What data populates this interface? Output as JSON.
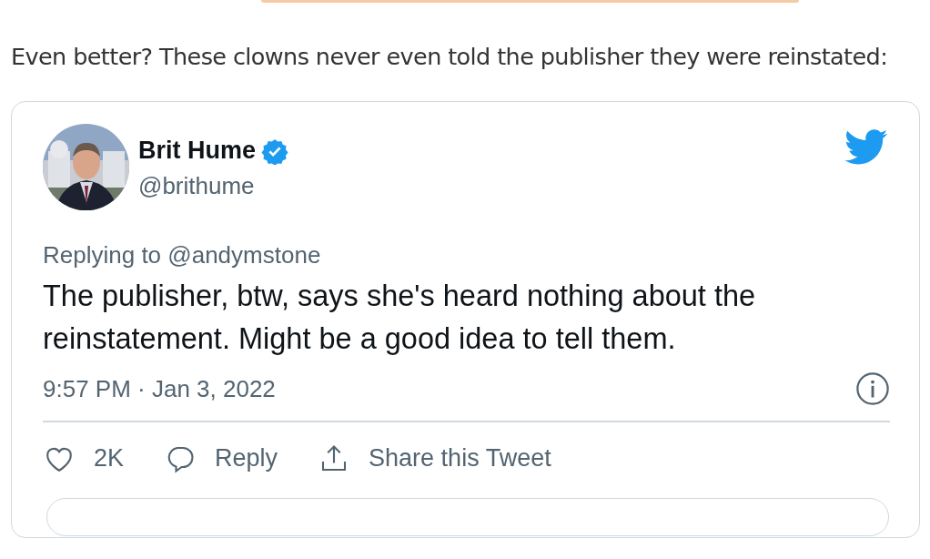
{
  "intro": "Even better? These clowns never even told the publisher they were reinstated:",
  "tweet": {
    "author": "Brit Hume",
    "verified": true,
    "handle": "@brithume",
    "replying_to": "Replying to @andymstone",
    "text": "The publisher, btw, says she's heard nothing about the reinstatement. Might be a good idea to tell them.",
    "timestamp": "9:57 PM · Jan 3, 2022",
    "actions": [
      {
        "kind": "like",
        "label": "2K"
      },
      {
        "kind": "reply",
        "label": "Reply"
      },
      {
        "kind": "share",
        "label": "Share this Tweet"
      }
    ]
  }
}
